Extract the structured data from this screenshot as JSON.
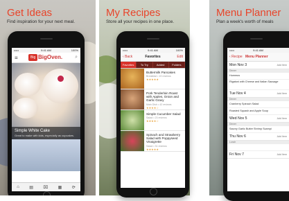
{
  "panels": [
    {
      "heading": "Get Ideas",
      "subheading": "Find inspiration for your next meal."
    },
    {
      "heading": "My Recipes",
      "subheading": "Store all your recipes in one place."
    },
    {
      "heading": "Menu Planner",
      "subheading": "Plan a week's worth of meals"
    }
  ],
  "status": {
    "carrier": "••••• ",
    "time": "9:41 AM",
    "battery": "100%"
  },
  "phone1": {
    "logo_badge": "Big",
    "logo_text": "BigOven.",
    "caption_title": "Simple White Cake",
    "caption_desc": "Great to make with kids, especially as cupcakes.",
    "tabs": [
      "⌂",
      "▤",
      "⌧",
      "▦",
      "⟳"
    ]
  },
  "phone2": {
    "back": "Back",
    "title": "Favorites",
    "edit": "Edit",
    "segments": [
      "Favorites",
      "To Try",
      "Added",
      "Folders"
    ],
    "recipes": [
      {
        "name": "Buttermilk Pancakes",
        "meta": "Breakfast • 19 reviews",
        "stars": "★★★★★"
      },
      {
        "name": "Pork Tenderloin Roast with Apples, Onion and Garlic Gravy",
        "meta": "Main Dish • 42 reviews",
        "stars": "★★★★☆"
      },
      {
        "name": "Simple Cucumber Salad",
        "meta": "Salad • 23 reviews",
        "stars": "★★★★☆"
      },
      {
        "name": "Spinach and Strawberry Salad with Poppyseed Vinaigrette",
        "meta": "Salad • 31 reviews",
        "stars": "★★★★★"
      }
    ]
  },
  "phone3": {
    "back": "Recipe",
    "title": "Menu Planner",
    "days": [
      {
        "day": "Mon Nov 3",
        "add": "Add Item",
        "slot": "Dinner",
        "items": [
          "Hummus",
          "Rigatoni with Cheese and Italian Sausage"
        ]
      },
      {
        "day": "Tue Nov 4",
        "add": "Add Item",
        "slot": "Dinner",
        "items": [
          "Cranberry Spinach Salad",
          "Roasted Squash and Apple Soup"
        ]
      },
      {
        "day": "Wed Nov 5",
        "add": "Add Item",
        "slot": "Dinner",
        "items": [
          "Savory Garlic Butter Shrimp Scampi"
        ]
      },
      {
        "day": "Thu Nov 6",
        "add": "Add Item",
        "slot": "Lunch",
        "items": [
          ""
        ]
      },
      {
        "day": "Fri Nov 7",
        "add": "Add Item",
        "slot": "",
        "items": []
      }
    ]
  },
  "colors": {
    "accent": "#e8442a",
    "nav_red": "#d8322a",
    "nav_dark": "#6b1f19"
  }
}
